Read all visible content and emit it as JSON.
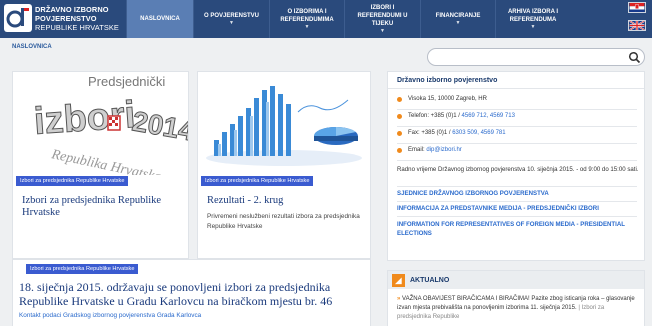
{
  "header": {
    "brand_line1": "DRŽAVNO IZBORNO",
    "brand_line2": "POVJERENSTVO",
    "brand_line3": "REPUBLIKE HRVATSKE",
    "nav": [
      {
        "label": "NASLOVNICA",
        "active": true
      },
      {
        "label": "O POVJERENSTVU",
        "active": false
      },
      {
        "label": "O IZBORIMA I REFERENDUMIMA",
        "active": false
      },
      {
        "label": "IZBORI I REFERENDUMI U TIJEKU",
        "active": false
      },
      {
        "label": "FINANCIRANJE",
        "active": false
      },
      {
        "label": "ARHIVA IZBORA I REFERENDUMA",
        "active": false
      }
    ]
  },
  "breadcrumb": "NASLOVNICA",
  "search": {
    "placeholder": "",
    "value": ""
  },
  "cards": [
    {
      "image_text1": "Predsjednički",
      "image_text2": "izbori",
      "image_text3": "2014",
      "image_text4": "Republika Hrvatska",
      "tag": "Izbori za predsjednika Republike Hrvatske",
      "title": "Izbori za predsjednika Republike Hrvatske"
    },
    {
      "tag": "Izbori za predsjednika Republike Hrvatske",
      "title": "Rezultati - 2. krug",
      "text": "Privremeni neslužbeni rezultati izbora za predsjednika Republike Hrvatske"
    },
    {
      "tag": "Izbori za predsjednika Republike Hrvatske",
      "title": "18. siječnja 2015. održavaju se ponovljeni izbori za predsjednika Republike Hrvatske u Gradu Karlovcu na biračkom mjestu br. 46",
      "link": "Kontakt podaci Gradskog izbornog povjerenstva Grada Karlovca"
    }
  ],
  "panel": {
    "title": "Državno izborno povjerenstvo",
    "address": "Visoka 15, 10000 Zagreb, HR",
    "phone_label": "Telefon: +385 (0)1 /",
    "phone_numbers": "4569 712, 4569 713",
    "fax_label": "Fax: +385 (0)1 /",
    "fax_numbers": "6303 509, 4569 781",
    "email_label": "Email:",
    "email": "dip@izbori.hr",
    "note": "Radno vrijeme Državnog izbornog povjerenstva 10. siječnja 2015. - od 9:00 do 15:00 sati.",
    "links": [
      "SJEDNICE DRŽAVNOG IZBORNOG POVJERENSTVA",
      "INFORMACIJA ZA PREDSTAVNIKE MEDIJA - PREDSJEDNIČKI IZBORI",
      "INFORMATION FOR REPRESENTATIVES OF FOREIGN MEDIA - PRESIDENTIAL ELECTIONS"
    ]
  },
  "aktualno": {
    "title": "AKTUALNO",
    "text": "VAŽNA OBAVIJEST BIRAČICAMA I BIRAČIMA! Pazite zbog isticanja roka – glasovanje izvan mjesta prebivališta na ponovljenim izborima 11. siječnja 2015.",
    "more": "| Izbori za predsjednika Republike"
  },
  "colors": {
    "navy": "#2a4a7c",
    "active": "#5a7eb4",
    "tag": "#3a5bd0",
    "accent": "#f08a1c",
    "link": "#2a6acc"
  }
}
